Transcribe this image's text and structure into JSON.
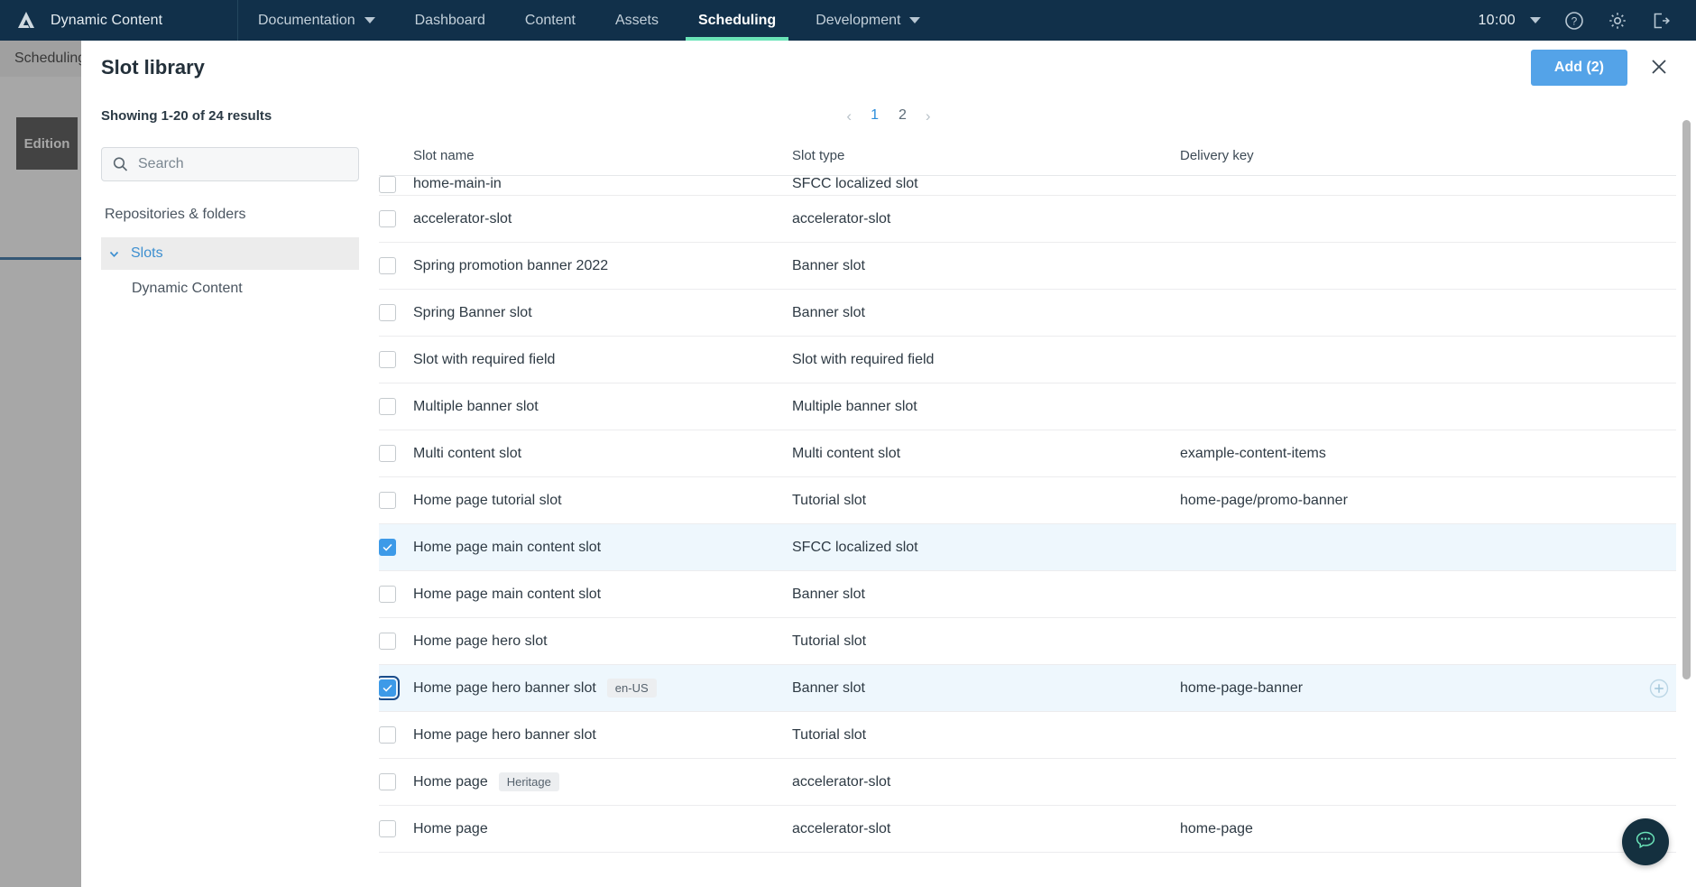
{
  "topnav": {
    "brand": "Dynamic Content",
    "items": [
      {
        "label": "Documentation",
        "caret": true,
        "active": false
      },
      {
        "label": "Dashboard",
        "caret": false,
        "active": false
      },
      {
        "label": "Content",
        "caret": false,
        "active": false
      },
      {
        "label": "Assets",
        "caret": false,
        "active": false
      },
      {
        "label": "Scheduling",
        "caret": false,
        "active": true
      },
      {
        "label": "Development",
        "caret": true,
        "active": false
      }
    ],
    "clock": "10:00",
    "icons": [
      "chevron-down-icon",
      "help-icon",
      "gear-icon",
      "logout-icon"
    ],
    "active_accent": "#6ae3b8",
    "background": "#11304a"
  },
  "background_page": {
    "breadcrumb": "Scheduling",
    "edition_card": "Edition"
  },
  "modal": {
    "title": "Slot library",
    "add_button": "Add (2)",
    "close_icon": "close-icon",
    "results": "Showing 1-20 of 24 results",
    "accent": "#54a3e8",
    "pagination": {
      "prev": "‹",
      "next": "›",
      "pages": [
        "1",
        "2"
      ],
      "current": "1"
    }
  },
  "sidebar": {
    "search": {
      "placeholder": "Search",
      "value": "",
      "icon": "search-icon"
    },
    "section_label": "Repositories & folders",
    "tree": {
      "root": {
        "label": "Slots",
        "expanded": true,
        "icon": "chevron-down-icon"
      },
      "children": [
        {
          "label": "Dynamic Content"
        }
      ]
    }
  },
  "table": {
    "columns": [
      "Slot name",
      "Slot type",
      "Delivery key"
    ],
    "rows": [
      {
        "name": "home-main-in",
        "type": "SFCC localized slot",
        "key": "",
        "checked": false,
        "clipped": true
      },
      {
        "name": "accelerator-slot",
        "type": "accelerator-slot",
        "key": "",
        "checked": false
      },
      {
        "name": "Spring promotion banner 2022",
        "type": "Banner slot",
        "key": "",
        "checked": false
      },
      {
        "name": "Spring Banner slot",
        "type": "Banner slot",
        "key": "",
        "checked": false
      },
      {
        "name": "Slot with required field",
        "type": "Slot with required field",
        "key": "",
        "checked": false
      },
      {
        "name": "Multiple banner slot",
        "type": "Multiple banner slot",
        "key": "",
        "checked": false
      },
      {
        "name": "Multi content slot",
        "type": "Multi content slot",
        "key": "example-content-items",
        "checked": false
      },
      {
        "name": "Home page tutorial slot",
        "type": "Tutorial slot",
        "key": "home-page/promo-banner",
        "checked": false
      },
      {
        "name": "Home page main content slot",
        "type": "SFCC localized slot",
        "key": "",
        "checked": true
      },
      {
        "name": "Home page main content slot",
        "type": "Banner slot",
        "key": "",
        "checked": false
      },
      {
        "name": "Home page hero slot",
        "type": "Tutorial slot",
        "key": "",
        "checked": false
      },
      {
        "name": "Home page hero banner slot",
        "badge": "en-US",
        "type": "Banner slot",
        "key": "home-page-banner",
        "checked": true,
        "focused": true,
        "add_icon": "add-circle-icon"
      },
      {
        "name": "Home page hero banner slot",
        "type": "Tutorial slot",
        "key": "",
        "checked": false
      },
      {
        "name": "Home page",
        "badge": "Heritage",
        "type": "accelerator-slot",
        "key": "",
        "checked": false
      },
      {
        "name": "Home page",
        "type": "accelerator-slot",
        "key": "home-page",
        "checked": false
      }
    ]
  },
  "chat": {
    "icon": "chat-bubble-icon",
    "color": "#14303f",
    "glyph_color": "#6ae3b8"
  }
}
